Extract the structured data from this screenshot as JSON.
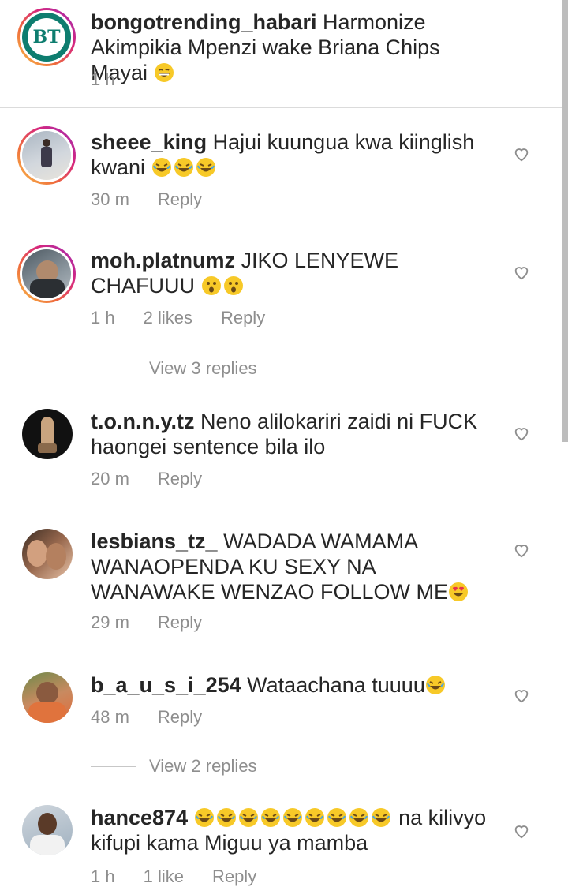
{
  "caption": {
    "username": "bongotrending_habari",
    "text": "Harmonize Akimpikia Mpenzi wake Briana Chips Mayai",
    "time": "1 h"
  },
  "comments": [
    {
      "username": "sheee_king",
      "text": "Hajui kuungua kwa kiinglish kwani",
      "emojis": "laugh-x3",
      "time": "30 m",
      "likes": "",
      "reply": "Reply"
    },
    {
      "username": "moh.platnumz",
      "text": "JIKO LENYEWE CHAFUUU",
      "emojis": "surprised-x2",
      "time": "1 h",
      "likes": "2 likes",
      "reply": "Reply",
      "view_replies": "View 3 replies"
    },
    {
      "username": "t.o.n.n.y.tz",
      "text": "Neno alilokariri zaidi ni FUCK haongei sentence bila ilo",
      "time": "20 m",
      "likes": "",
      "reply": "Reply"
    },
    {
      "username": "lesbians_tz_",
      "text": "WADADA WAMAMA WANAOPENDA KU SEXY NA WANAWAKE WENZAO FOLLOW ME",
      "emojis": "heart-eyes",
      "time": "29 m",
      "likes": "",
      "reply": "Reply"
    },
    {
      "username": "b_a_u_s_i_254",
      "text": "Wataachana tuuuu",
      "emojis": "laugh",
      "time": "48 m",
      "likes": "",
      "reply": "Reply",
      "view_replies": "View 2 replies"
    },
    {
      "username": "hance874",
      "text_after": "na kilivyo kifupi kama Miguu ya mamba",
      "emojis": "laugh-x9",
      "time": "1 h",
      "likes": "1 like",
      "reply": "Reply"
    }
  ],
  "colors": {
    "secondary_text": "#8e8e8e",
    "accent": "#008a7a",
    "story_ring": "#e1306c"
  }
}
